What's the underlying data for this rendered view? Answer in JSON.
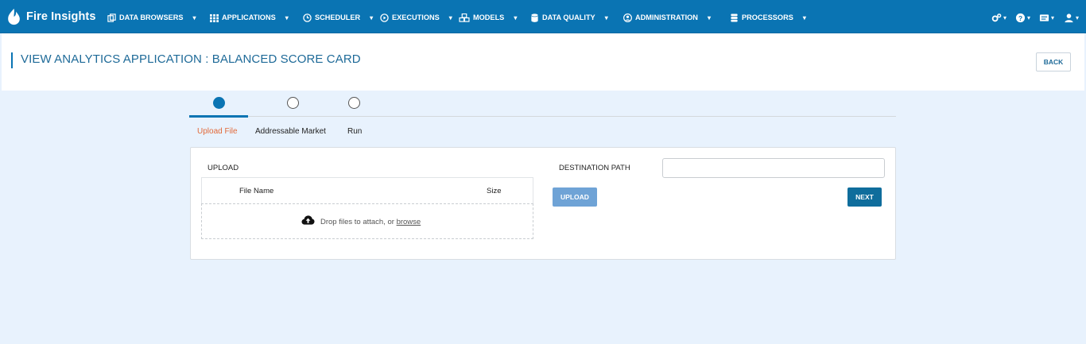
{
  "brand": {
    "name": "Fire Insights"
  },
  "nav": {
    "items": [
      {
        "label": "DATA BROWSERS",
        "icon": "copy-icon"
      },
      {
        "label": "APPLICATIONS",
        "icon": "grid-icon"
      },
      {
        "label": "SCHEDULER",
        "icon": "clock-icon"
      },
      {
        "label": "EXECUTIONS",
        "icon": "play-circle-icon"
      },
      {
        "label": "MODELS",
        "icon": "cubes-icon"
      },
      {
        "label": "DATA QUALITY",
        "icon": "database-icon"
      },
      {
        "label": "ADMINISTRATION",
        "icon": "user-circle-icon"
      },
      {
        "label": "PROCESSORS",
        "icon": "server-icon"
      }
    ],
    "caret": "▾",
    "right_icons": [
      "settings-icon",
      "help-icon",
      "messages-icon",
      "user-icon"
    ]
  },
  "header": {
    "title": "VIEW ANALYTICS APPLICATION : BALANCED SCORE CARD",
    "back_label": "BACK"
  },
  "steps": [
    {
      "label": "Upload File",
      "active": true
    },
    {
      "label": "Addressable Market",
      "active": false
    },
    {
      "label": "Run",
      "active": false
    }
  ],
  "upload": {
    "label": "UPLOAD",
    "columns": [
      "File Name",
      "Size"
    ],
    "drop_text": "Drop files to attach, or ",
    "browse_link": "browse",
    "upload_button": "UPLOAD"
  },
  "destination": {
    "label": "DESTINATION PATH",
    "value": "",
    "placeholder": ""
  },
  "actions": {
    "next_label": "NEXT"
  },
  "colors": {
    "nav_bg": "#0a74b3",
    "page_bg": "#e8f2fd",
    "active_step": "#e26a3a",
    "next_button": "#0f6d9c",
    "upload_button": "#6fa3d6"
  }
}
